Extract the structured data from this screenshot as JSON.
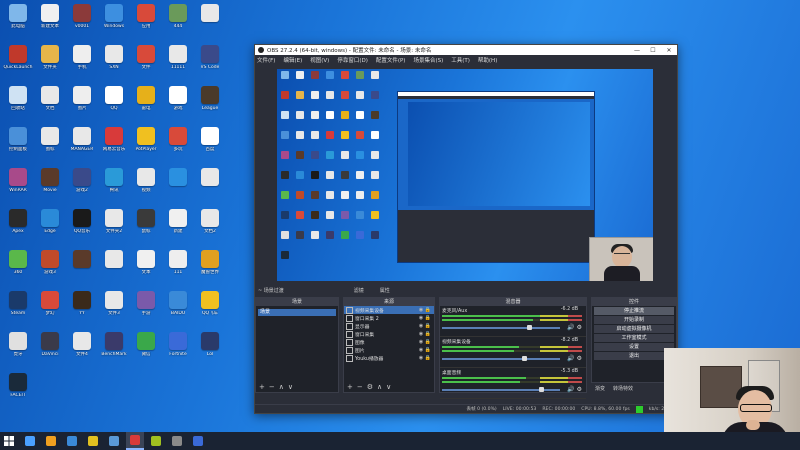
{
  "desktop": {
    "icons": [
      {
        "label": "此电脑",
        "color": "#7fb7ea"
      },
      {
        "label": "新建文本",
        "color": "#f0f0f0"
      },
      {
        "label": "v0001",
        "color": "#8b3a3a"
      },
      {
        "label": "Windows",
        "color": "#3d8fe0"
      },
      {
        "label": "应用",
        "color": "#d84a3a"
      },
      {
        "label": "444",
        "color": "#6a9a5a"
      },
      {
        "label": "",
        "color": "#e8e8e8"
      },
      {
        "label": "QuickLaunch",
        "color": "#c0392b"
      },
      {
        "label": "文件夹",
        "color": "#e6b54a"
      },
      {
        "label": "手机",
        "color": "#eeeeee"
      },
      {
        "label": "SXN",
        "color": "#e8e8e8"
      },
      {
        "label": "文件",
        "color": "#d84a3a"
      },
      {
        "label": "11111",
        "color": "#e8e8e8"
      },
      {
        "label": "VS Code",
        "color": "#3a4a8a"
      },
      {
        "label": "回收站",
        "color": "#cfe2f3"
      },
      {
        "label": "文档",
        "color": "#e8e8e8"
      },
      {
        "label": "图片",
        "color": "#eeeeee"
      },
      {
        "label": "QQ",
        "color": "#ffffff"
      },
      {
        "label": "雷电",
        "color": "#e6b01a"
      },
      {
        "label": "游戏",
        "color": "#ffffff"
      },
      {
        "label": "League",
        "color": "#4a3a2a"
      },
      {
        "label": "控制面板",
        "color": "#4a90d9"
      },
      {
        "label": "图标",
        "color": "#e8e8e8"
      },
      {
        "label": "MANAGER",
        "color": "#e8e8e8"
      },
      {
        "label": "网易云音乐",
        "color": "#d83a3a"
      },
      {
        "label": "PotPlayer",
        "color": "#f0c020"
      },
      {
        "label": "多玩",
        "color": "#d84a3a"
      },
      {
        "label": "百度",
        "color": "#ffffff"
      },
      {
        "label": "WinRAR",
        "color": "#a84a8a"
      },
      {
        "label": "Movie",
        "color": "#5a3a2a"
      },
      {
        "label": "游戏2",
        "color": "#3a4a8a"
      },
      {
        "label": "腾讯",
        "color": "#2a9ad8"
      },
      {
        "label": "视频",
        "color": "#e8e8e8"
      },
      {
        "label": "",
        "color": "#2a90e0"
      },
      {
        "label": "",
        "color": "#e8e8e8"
      },
      {
        "label": "Apex",
        "color": "#2a2a2a"
      },
      {
        "label": "Edge",
        "color": "#2a8ad8"
      },
      {
        "label": "QQ音乐",
        "color": "#1a1a1a"
      },
      {
        "label": "文件夹2",
        "color": "#e8e8e8"
      },
      {
        "label": "鼠标",
        "color": "#3a3a3a"
      },
      {
        "label": "新建",
        "color": "#f0f0f0"
      },
      {
        "label": "文档2",
        "color": "#e8e8e8"
      },
      {
        "label": "360",
        "color": "#5ab84a"
      },
      {
        "label": "游戏3",
        "color": "#c04a2a"
      },
      {
        "label": "",
        "color": "#5a3a2a"
      },
      {
        "label": "",
        "color": "#e8e8e8"
      },
      {
        "label": "文本",
        "color": "#f0f0f0"
      },
      {
        "label": "111",
        "color": "#eeeeee"
      },
      {
        "label": "魔兽世界",
        "color": "#e0a020"
      },
      {
        "label": "Steam",
        "color": "#1a3a6a"
      },
      {
        "label": "梦幻",
        "color": "#d84a3a"
      },
      {
        "label": "YY",
        "color": "#3a2a1a"
      },
      {
        "label": "文件3",
        "color": "#e8e8e8"
      },
      {
        "label": "手游",
        "color": "#7a5aaa"
      },
      {
        "label": "BAIDU",
        "color": "#3a8ad8"
      },
      {
        "label": "QQ飞车",
        "color": "#f0c020"
      },
      {
        "label": "虎牙",
        "color": "#e0e0e0"
      },
      {
        "label": "DaVinci",
        "color": "#3a3a4a"
      },
      {
        "label": "文件4",
        "color": "#e8e8e8"
      },
      {
        "label": "BenchMark",
        "color": "#3a3a6a"
      },
      {
        "label": "微信",
        "color": "#3aa84a"
      },
      {
        "label": "Fortnite",
        "color": "#3a6ad8"
      },
      {
        "label": "Lol",
        "color": "#2a3a6a"
      },
      {
        "label": "FACEIT",
        "color": "#1a2a3a"
      }
    ]
  },
  "obs": {
    "title": "OBS 27.2.4 (64-bit, windows) - 配置文件: 未命名 - 场景: 未命名",
    "menu": [
      "文件(F)",
      "编辑(E)",
      "视图(V)",
      "停靠窗口(D)",
      "配置文件(P)",
      "场景集合(S)",
      "工具(T)",
      "帮助(H)"
    ],
    "scene_transitions_label": "~ 场景过渡",
    "filters_label": "滤镜",
    "properties_label": "属性",
    "docks": {
      "scenes": {
        "title": "场景",
        "items": [
          "场景"
        ]
      },
      "sources": {
        "title": "来源",
        "items": [
          "视频采集设备",
          "窗口采集 2",
          "显示器",
          "窗口采集",
          "图像",
          "图片",
          "Youku播放器"
        ]
      },
      "mixer": {
        "title": "混音器",
        "channels": [
          {
            "name": "麦克风/Aux",
            "db": "-6.2 dB"
          },
          {
            "name": "视频采集设备",
            "db": "-8.2 dB"
          },
          {
            "name": "桌面音频",
            "db": "-5.3 dB"
          }
        ]
      },
      "controls": {
        "title": "控件",
        "buttons": [
          "停止推流",
          "开始录制",
          "启动虚拟摄像机",
          "工作室模式",
          "设置",
          "退出"
        ]
      }
    },
    "scene_transition_dock": {
      "fade": "渐变",
      "duration": "转场特效"
    },
    "status": [
      "丢帧 0 (0.0%)",
      "LIVE: 00:00:53",
      "REC: 00:00:00",
      "CPU: 8.8%, 60.00 fps",
      "kb/s: 2758"
    ]
  },
  "taskbar": {
    "items": [
      {
        "name": "start",
        "color": "#ffffff"
      },
      {
        "name": "search",
        "color": "#4aa0ff"
      },
      {
        "name": "app1",
        "color": "#f0a020"
      },
      {
        "name": "app2",
        "color": "#3a8ad8"
      },
      {
        "name": "app3",
        "color": "#e0c020"
      },
      {
        "name": "app4",
        "color": "#5a9ad8"
      },
      {
        "name": "obs",
        "color": "#d83a3a"
      },
      {
        "name": "app5",
        "color": "#a0c020"
      },
      {
        "name": "app6",
        "color": "#8a8a8a"
      },
      {
        "name": "steam",
        "color": "#3a6ad8"
      }
    ]
  },
  "colors": {
    "desktop_bg": "#1a74d8",
    "obs_bg": "#2b2e38",
    "accent": "#3a6fb5"
  }
}
